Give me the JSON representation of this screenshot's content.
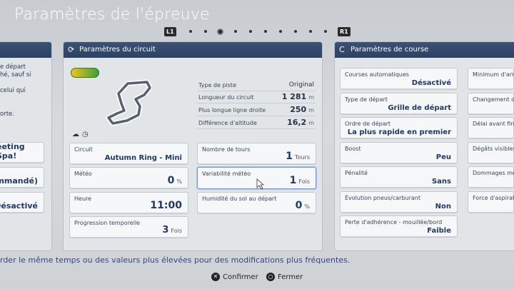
{
  "title": "Paramètres de l'épreuve",
  "pager": {
    "left": "L1",
    "right": "R1",
    "dots": 10,
    "active": 2
  },
  "left_panel": {
    "text_lines": [
      "e départ",
      "hé, sauf si",
      "",
      "celui qui",
      "",
      "orte."
    ],
    "boxes": [
      "eeting Spa!",
      "ecommandé)",
      "Désactivé"
    ]
  },
  "circuit_panel": {
    "header": "Paramètres du circuit",
    "info": [
      {
        "label": "Type de piste",
        "value": "Original",
        "unit": ""
      },
      {
        "label": "Longueur du circuit",
        "value": "1 281",
        "unit": "m"
      },
      {
        "label": "Plus longue ligne droite",
        "value": "250",
        "unit": "m"
      },
      {
        "label": "Différence d'altitude",
        "value": "16,2",
        "unit": "m"
      }
    ],
    "fields": [
      {
        "label": "Circuit",
        "value": "Autumn Ring - Mini",
        "unit": ""
      },
      {
        "label": "Météo",
        "value": "0",
        "unit": "%"
      },
      {
        "label": "Heure",
        "value": "11:00",
        "unit": ""
      },
      {
        "label": "Progression temporelle",
        "value": "3",
        "unit": "Fois"
      },
      {
        "label": "Nombre de tours",
        "value": "1",
        "unit": "Tours"
      },
      {
        "label": "Variabilité météo",
        "value": "1",
        "unit": "Fois"
      },
      {
        "label": "Humidité du sol au départ",
        "value": "0",
        "unit": "%"
      }
    ]
  },
  "race_panel": {
    "header": "Paramètres de course",
    "fields": [
      {
        "label": "Courses automatiques",
        "value": "Désactivé"
      },
      {
        "label": "Type de départ",
        "value": "Grille de départ"
      },
      {
        "label": "Ordre de départ",
        "value": "La plus rapide en premier"
      },
      {
        "label": "Boost",
        "value": "Peu"
      },
      {
        "label": "Pénalité",
        "value": "Sans"
      },
      {
        "label": "Évolution pneus/carburant",
        "value": "Non"
      },
      {
        "label": "Perte d'adhérence - mouillée/bord",
        "value": "Faible"
      }
    ],
    "right_labels": [
      "Minimum d'arrê",
      "Changement de",
      "Délai avant fin d",
      "Dégâts visibles",
      "Dommages méc",
      "Force d'aspiratio"
    ]
  },
  "hint": "rder le même temps ou des valeurs plus élevées pour des modifications plus fréquentes.",
  "footer": {
    "confirm": "Confirmer",
    "close": "Fermer"
  }
}
